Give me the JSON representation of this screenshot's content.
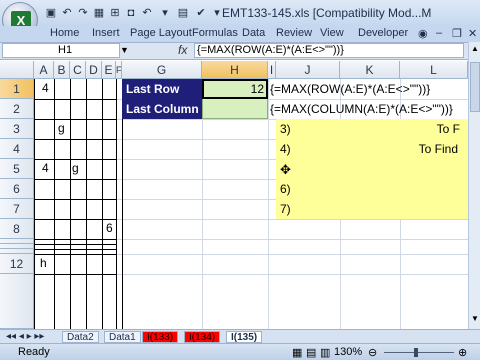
{
  "window": {
    "title": "EMT133-145.xls  [Compatibility Mod...M"
  },
  "ribbon": {
    "tabs": [
      "Home",
      "Insert",
      "Page Layout",
      "Formulas",
      "Data",
      "Review",
      "View",
      "Developer"
    ]
  },
  "formula_bar": {
    "name_box": "H1",
    "fx": "fx",
    "formula": "{=MAX(ROW(A:E)*(A:E<>\"\"))}"
  },
  "columns": [
    "A",
    "B",
    "C",
    "D",
    "E",
    "F",
    "G",
    "H",
    "I",
    "J",
    "K",
    "L"
  ],
  "rows": [
    "1",
    "2",
    "3",
    "4",
    "5",
    "6",
    "7",
    "8",
    "",
    "",
    "",
    "12",
    ""
  ],
  "cells": {
    "a1": "4",
    "b3": "g",
    "a5": "4",
    "c5": "g",
    "e8": "6",
    "a12": "h",
    "g1": "Last Row",
    "g2": "Last Column",
    "h1": "12",
    "j1": "{=MAX(ROW(A:E)*(A:E<>\"\"))}",
    "j2": "{=MAX(COLUMN(A:E)*(A:E<>\"\"))}",
    "j3": "3)",
    "j4": "4)",
    "j6": "6)",
    "j7": "7)",
    "k3": "To F",
    "k4": "To Find"
  },
  "sheet_tabs": [
    "Data2",
    "Data1",
    "I(133)",
    "I(134)",
    "I(135)"
  ],
  "status": {
    "ready": "Ready",
    "zoom": "130%"
  },
  "colors": {
    "dark_blue": "#1f1f7a",
    "green": "#d8f0c0",
    "yellow": "#ffff99",
    "red": "#ff0000"
  }
}
